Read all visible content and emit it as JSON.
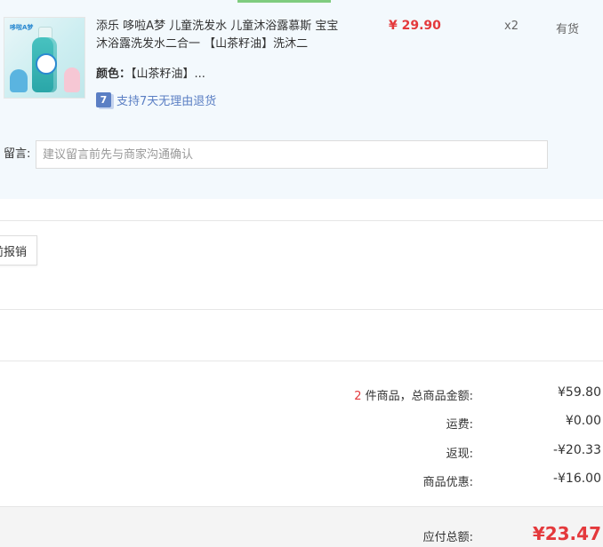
{
  "product": {
    "title": "添乐 哆啦A梦 儿童洗发水 儿童沐浴露慕斯 宝宝沐浴露洗发水二合一 【山茶籽油】洗沐二",
    "price": "¥ 29.90",
    "quantity": "x2",
    "stock": "有货",
    "attr_label": "颜色：",
    "attr_value": "【山茶籽油】...",
    "return_badge": "7",
    "return_text": "支持7天无理由退货",
    "image_brand": "哆啦A梦"
  },
  "remark": {
    "label": "留言:",
    "placeholder": "建议留言前先与商家沟通确认"
  },
  "invoice": {
    "button_label": "前报销"
  },
  "summary": {
    "count": "2",
    "count_suffix": " 件商品，总商品金额:",
    "total_value": "¥59.80",
    "shipping_label": "运费:",
    "shipping_value": "¥0.00",
    "rebate_label": "返现:",
    "rebate_value": "-¥20.33",
    "discount_label": "商品优惠:",
    "discount_value": "-¥16.00",
    "payable_label": "应付总额:",
    "payable_value": "¥23.47"
  },
  "colors": {
    "price_red": "#e4393c",
    "panel_bg": "#f3f9fd",
    "service_blue": "#5b7fc4",
    "accent_green": "#7fcc7f"
  }
}
